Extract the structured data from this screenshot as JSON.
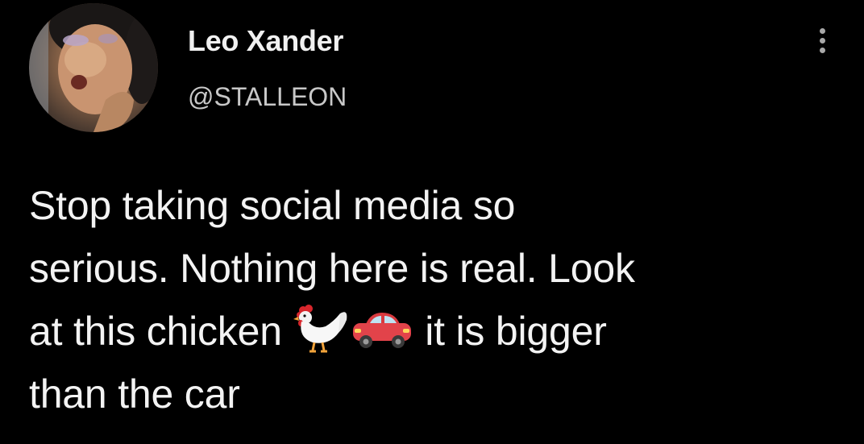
{
  "tweet": {
    "author": {
      "display_name": "Leo Xander",
      "handle": "@STALLEON"
    },
    "text_lines": {
      "line1": "Stop taking social media so",
      "line2": "serious. Nothing here is real. Look",
      "line3_before": "at this chicken ",
      "line3_after": " it is bigger",
      "line4": "than the car"
    },
    "emojis": [
      "rooster-emoji",
      "car-emoji"
    ],
    "more_icon": "vertical-ellipsis-icon"
  }
}
